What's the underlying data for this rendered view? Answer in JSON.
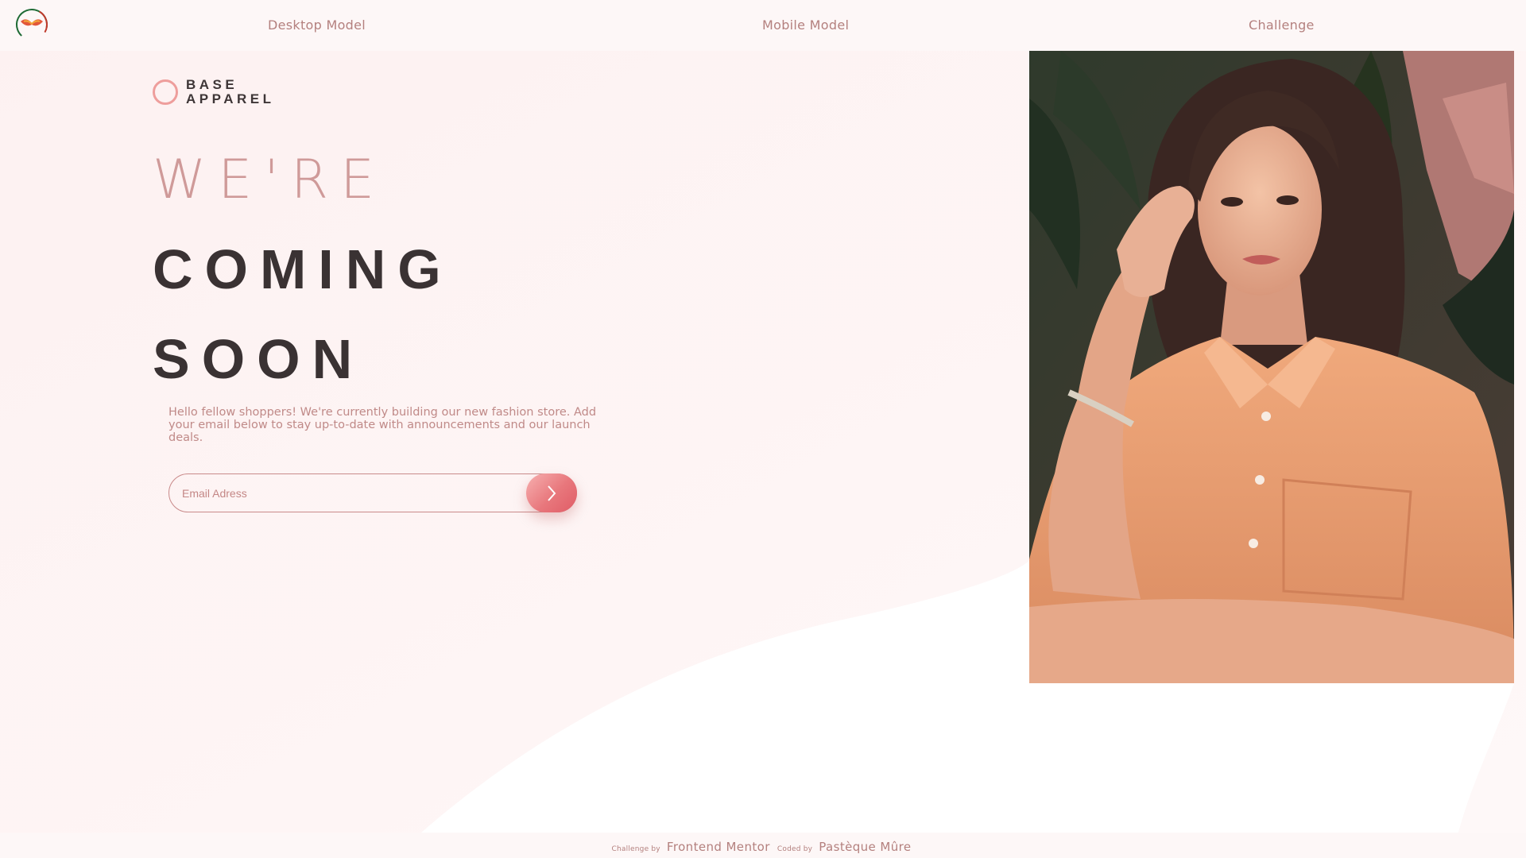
{
  "nav": {
    "links": [
      "Desktop Model",
      "Mobile Model",
      "Challenge"
    ]
  },
  "brand": {
    "line1": "BASE",
    "line2": "APPAREL"
  },
  "headline": {
    "line1": "WE'RE",
    "line2": "COMING",
    "line3": "SOON"
  },
  "description": "Hello fellow shoppers! We're currently building our new fashion store. Add your email below to stay up-to-date with announcements and our launch deals.",
  "form": {
    "placeholder": "Email Adress",
    "submit_icon": "chevron-right-icon"
  },
  "footer": {
    "challenge_prefix": "Challenge by",
    "challenge_link": "Frontend Mentor",
    "coded_prefix": "Coded by",
    "coded_link": "Pastèque Mûre"
  },
  "colors": {
    "accent": "#ce9797",
    "background": "#fdf4f4",
    "dark_text": "#423a3a",
    "button_gradient": [
      "#f8bfbf",
      "#ee8c8c"
    ]
  }
}
